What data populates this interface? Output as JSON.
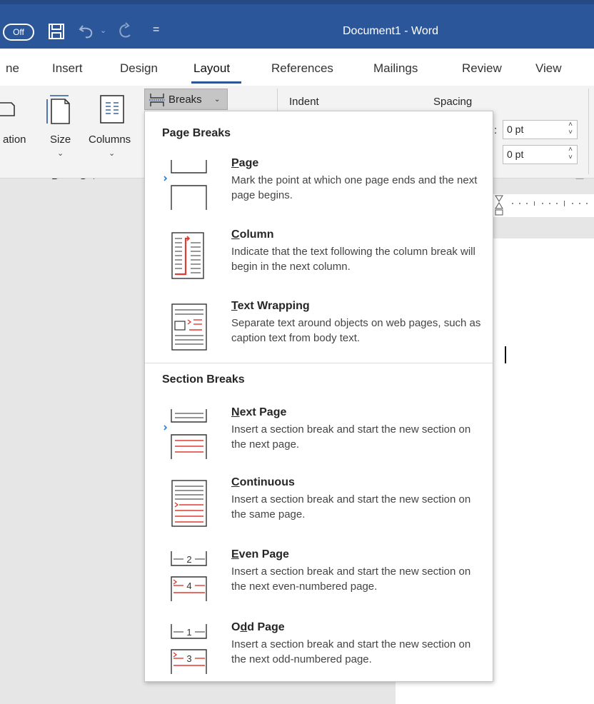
{
  "titlebar": {
    "autosave_label": "Off",
    "document_title": "Document1 - Word",
    "qat_more": "="
  },
  "tabs": [
    {
      "label": "ne"
    },
    {
      "label": "Insert"
    },
    {
      "label": "Design"
    },
    {
      "label": "Layout",
      "active": true
    },
    {
      "label": "References"
    },
    {
      "label": "Mailings"
    },
    {
      "label": "Review"
    },
    {
      "label": "View"
    }
  ],
  "ribbon": {
    "orientation_label": "ation",
    "size_label": "Size",
    "columns_label": "Columns",
    "group_label": "Page Setup",
    "breaks_label": "Breaks",
    "indent_label": "Indent",
    "spacing_label": "Spacing",
    "spacing_before": "0 pt",
    "spacing_after": "0 pt",
    "colon": ":"
  },
  "breaks_menu": {
    "page_breaks_heading": "Page Breaks",
    "section_breaks_heading": "Section Breaks",
    "items": [
      {
        "title": "Page",
        "mnemonic": "P",
        "rest": "age",
        "description": "Mark the point at which one page ends and the next page begins.",
        "icon": "page-break-icon"
      },
      {
        "title": "Column",
        "mnemonic": "C",
        "rest": "olumn",
        "description": "Indicate that the text following the column break will begin in the next column.",
        "icon": "column-break-icon"
      },
      {
        "title": "Text Wrapping",
        "mnemonic": "T",
        "rest": "ext Wrapping",
        "description": "Separate text around objects on web pages, such as caption text from body text.",
        "icon": "text-wrapping-icon"
      },
      {
        "title": "Next Page",
        "mnemonic": "N",
        "rest": "ext Page",
        "description": "Insert a section break and start the new section on the next page.",
        "icon": "next-page-icon"
      },
      {
        "title": "Continuous",
        "mnemonic": "C",
        "rest": "ontinuous",
        "description": "Insert a section break and start the new section on the same page.",
        "icon": "continuous-icon"
      },
      {
        "title": "Even Page",
        "mnemonic": "E",
        "rest": "ven Page",
        "description": "Insert a section break and start the new section on the next even-numbered page.",
        "icon": "even-page-icon"
      },
      {
        "title": "Odd Page",
        "pre": "O",
        "mnemonic": "d",
        "rest": "d Page",
        "description": "Insert a section break and start the new section on the next odd-numbered page.",
        "icon": "odd-page-icon"
      }
    ]
  },
  "colors": {
    "accent": "#2b579a",
    "break_red": "#e03c31",
    "selection_blue": "#2b7cd3"
  }
}
